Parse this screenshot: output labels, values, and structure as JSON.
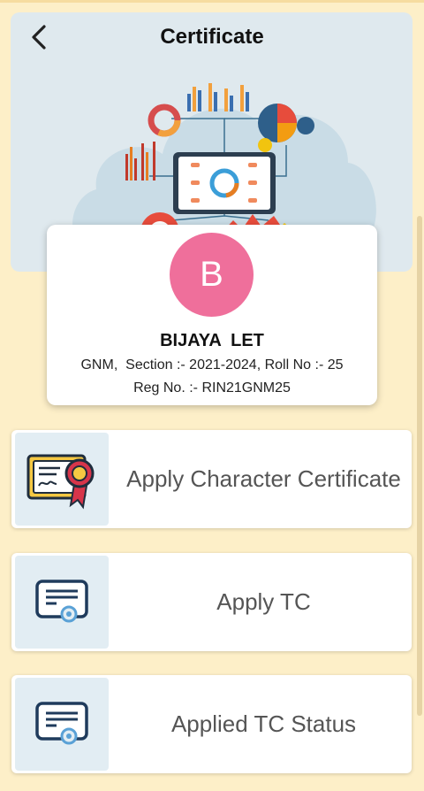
{
  "header": {
    "title": "Certificate",
    "back_icon": "chevron-left-icon"
  },
  "profile": {
    "avatar_letter": "B",
    "avatar_color": "#ef6f9b",
    "name": "BIJAYA  LET",
    "course_line": "GNM,  Section :- 2021-2024, Roll No :- 25",
    "reg_line": "Reg No. :- RIN21GNM25"
  },
  "menu": [
    {
      "label": "Apply Character Certificate",
      "icon": "certificate-ribbon-icon"
    },
    {
      "label": "Apply TC",
      "icon": "certificate-badge-icon"
    },
    {
      "label": "Applied TC Status",
      "icon": "certificate-badge-icon"
    }
  ],
  "colors": {
    "background": "#fdefc8",
    "header_card": "#dfe9ee",
    "icon_box": "#e2edf3"
  }
}
